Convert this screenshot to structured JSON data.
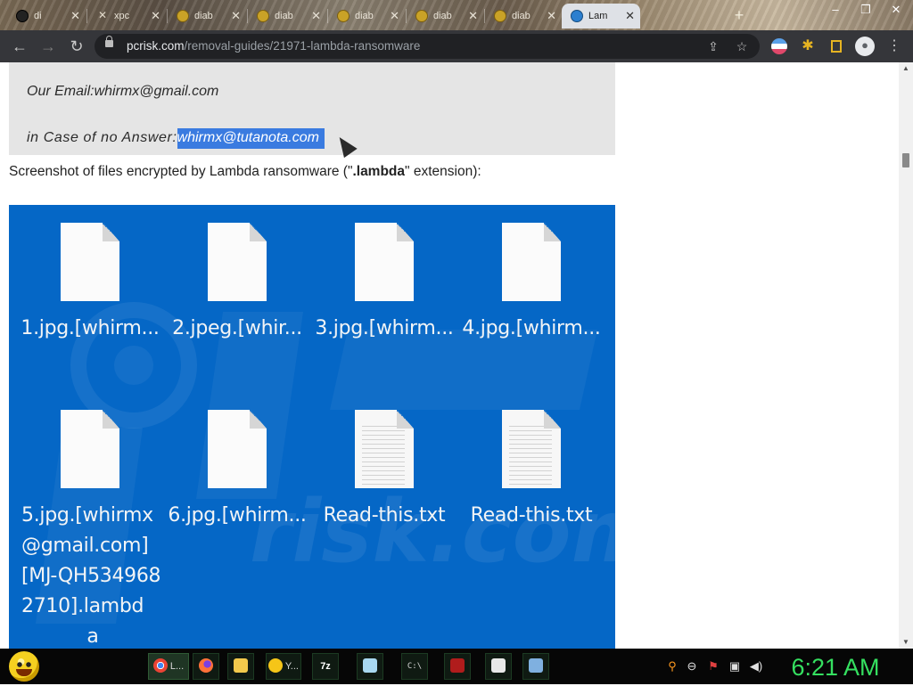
{
  "browser": {
    "tabs": [
      {
        "title": "di",
        "icon": "github-icon"
      },
      {
        "title": "xpc",
        "icon": "close-x-icon"
      },
      {
        "title": "diab",
        "icon": "site-icon"
      },
      {
        "title": "diab",
        "icon": "site-icon"
      },
      {
        "title": "diab",
        "icon": "site-icon"
      },
      {
        "title": "diab",
        "icon": "site-icon"
      },
      {
        "title": "diab",
        "icon": "site-icon"
      },
      {
        "title": "Lam",
        "icon": "pcrisk-icon",
        "active": true
      }
    ],
    "new_tab_label": "+",
    "window_controls": [
      "–",
      "❐",
      "✕"
    ],
    "url_host": "pcrisk.com",
    "url_path": "/removal-guides/21971-lambda-ransomware",
    "toolbar_icons": [
      "back-icon",
      "forward-icon",
      "reload-icon",
      "share-icon",
      "star-icon",
      "extension-flag-icon",
      "puzzle-icon",
      "side-panel-icon",
      "profile-icon",
      "menu-icon"
    ]
  },
  "page": {
    "email_box": {
      "line1": "Our Email:whirmx@gmail.com",
      "line2_prefix": "in Case of no Answer:",
      "line2_selected": "whirmx@tutanota.com"
    },
    "caption_pre": "Screenshot of files encrypted by Lambda ransomware (\"",
    "caption_bold": ".lambda",
    "caption_post": "\" extension):",
    "watermark_text": "risk.com",
    "files": [
      {
        "name": "1.jpg.[whirm...",
        "type": "blank"
      },
      {
        "name": "2.jpeg.[whir...",
        "type": "blank"
      },
      {
        "name": "3.jpg.[whirm...",
        "type": "blank"
      },
      {
        "name": "4.jpg.[whirm...",
        "type": "blank"
      },
      {
        "name": "5.jpg.[whirmx@gmail.com][MJ-QH5349682710].lambd",
        "name_last": "a",
        "type": "blank"
      },
      {
        "name": "6.jpg.[whirm...",
        "type": "blank"
      },
      {
        "name": "Read-this.txt",
        "type": "text"
      },
      {
        "name": "Read-this.txt",
        "type": "text"
      }
    ]
  },
  "taskbar": {
    "items": [
      {
        "label": "L...",
        "icon": "chrome-icon",
        "active": true
      },
      {
        "label": "",
        "icon": "firefox-icon"
      },
      {
        "label": "",
        "icon": "folder-icon"
      },
      {
        "label": "Y...",
        "icon": "smiley-icon"
      },
      {
        "label": "7z",
        "icon": "7zip-icon"
      },
      {
        "label": "",
        "icon": "notepad-icon"
      },
      {
        "label": "C:\\",
        "icon": "cmd-icon"
      },
      {
        "label": "",
        "icon": "flash-icon"
      },
      {
        "label": "",
        "icon": "window-icon"
      },
      {
        "label": "",
        "icon": "display-icon"
      }
    ],
    "tray_icons": [
      "search-icon",
      "minus-circle-icon",
      "flag-icon",
      "network-icon",
      "volume-icon"
    ],
    "clock": "6:21 AM"
  }
}
